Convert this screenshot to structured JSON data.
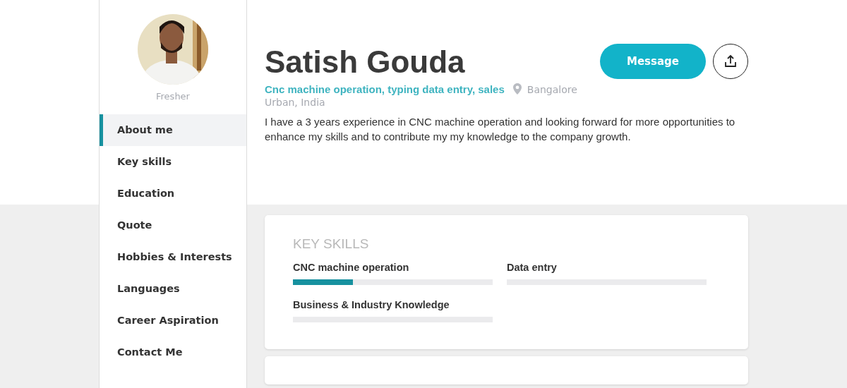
{
  "profile": {
    "status": "Fresher",
    "name": "Satish Gouda",
    "headline": "Cnc machine operation, typing data entry, sales",
    "location": [
      "Bangalore",
      "Urban, India"
    ],
    "summary": "I have a 3 years experience in CNC machine operation and looking forward for more opportunities to enhance my skills and to contribute my my knowledge to the company growth."
  },
  "actions": {
    "message_button": "Message"
  },
  "sidebar": {
    "items": [
      {
        "label": "About me",
        "selected": true
      },
      {
        "label": "Key skills",
        "selected": false
      },
      {
        "label": "Education",
        "selected": false
      },
      {
        "label": "Quote",
        "selected": false
      },
      {
        "label": "Hobbies & Interests",
        "selected": false
      },
      {
        "label": "Languages",
        "selected": false
      },
      {
        "label": "Career Aspiration",
        "selected": false
      },
      {
        "label": "Contact Me",
        "selected": false
      }
    ]
  },
  "key_skills": {
    "title": "KEY SKILLS",
    "skills": [
      {
        "name": "CNC machine operation",
        "level": 0.3
      },
      {
        "name": "Data entry",
        "level": 0
      },
      {
        "name": "Business & Industry Knowledge",
        "level": 0
      }
    ]
  }
}
